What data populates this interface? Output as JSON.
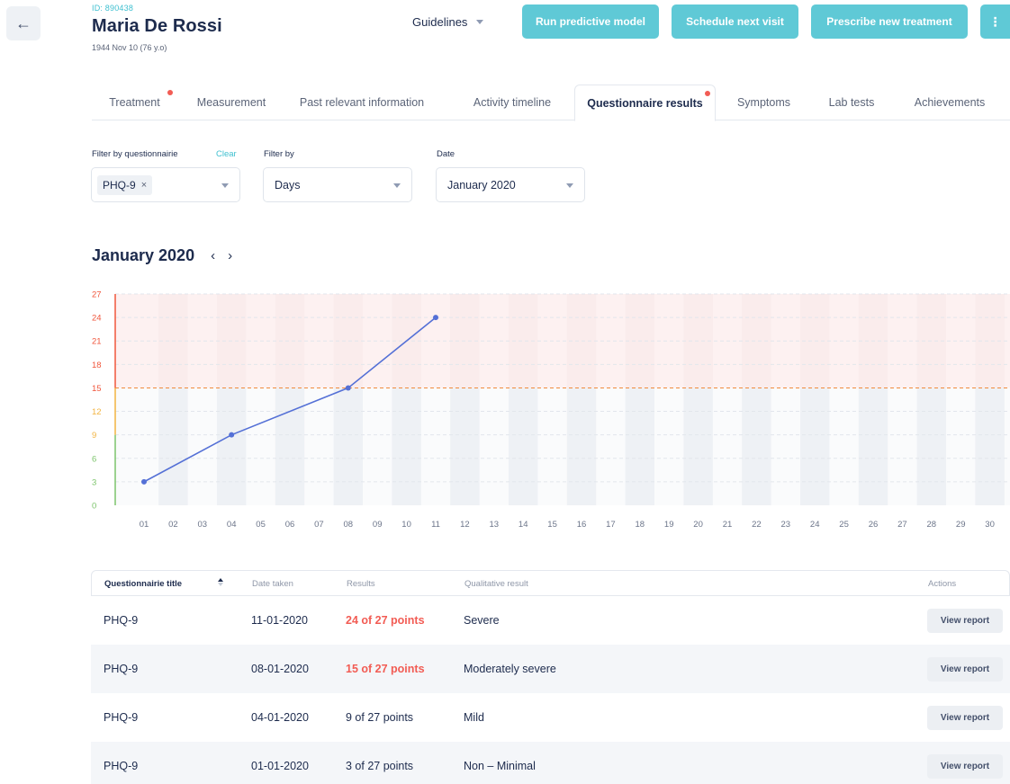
{
  "header": {
    "back_icon": "arrow-left-icon",
    "patient_id": "ID: 890438",
    "patient_name": "Maria De Rossi",
    "patient_dob": "1944 Nov 10 (76 y.o)",
    "guidelines_label": "Guidelines",
    "buttons": {
      "run_model": "Run predictive model",
      "schedule": "Schedule next visit",
      "prescribe": "Prescribe new treatment",
      "more": "⋮"
    },
    "button_color": "#5fc9d6"
  },
  "tabs": [
    {
      "label": "Treatment",
      "has_dot": true
    },
    {
      "label": "Measurement",
      "has_dot": false
    },
    {
      "label": "Past relevant information",
      "has_dot": false
    },
    {
      "label": "Activity timeline",
      "has_dot": false
    },
    {
      "label": "Questionnaire results",
      "has_dot": true,
      "active": true
    },
    {
      "label": "Symptoms",
      "has_dot": false
    },
    {
      "label": "Lab tests",
      "has_dot": false
    },
    {
      "label": "Achievements",
      "has_dot": false
    }
  ],
  "filters": {
    "questionnaire_label": "Filter by questionnairie",
    "clear_label": "Clear",
    "questionnaire_chip": "PHQ-9",
    "chip_remove": "×",
    "filter_by_label": "Filter by",
    "filter_by_value": "Days",
    "date_label": "Date",
    "date_value": "January 2020"
  },
  "month_nav": {
    "title": "January 2020",
    "prev": "‹",
    "next": "›"
  },
  "chart_data": {
    "type": "line",
    "x": [
      "01",
      "02",
      "03",
      "04",
      "05",
      "06",
      "07",
      "08",
      "09",
      "10",
      "11",
      "12",
      "13",
      "14",
      "15",
      "16",
      "17",
      "18",
      "19",
      "20",
      "21",
      "22",
      "23",
      "24",
      "25",
      "26",
      "27",
      "28",
      "29",
      "30"
    ],
    "series": [
      {
        "points": [
          {
            "x": "01",
            "y": 3
          },
          {
            "x": "04",
            "y": 9
          },
          {
            "x": "08",
            "y": 15
          },
          {
            "x": "11",
            "y": 24
          }
        ]
      }
    ],
    "yticks": [
      0,
      3,
      6,
      9,
      12,
      15,
      18,
      21,
      24,
      27
    ],
    "ylim": [
      0,
      27
    ],
    "threshold": 15,
    "grid": true,
    "colors": {
      "line": "#5470d6",
      "threshold": "#f08a3c",
      "high_zone": "#fdf1f1",
      "low_tick": "#7cc46b",
      "mid_tick": "#f2b441",
      "high_tick": "#f0563c"
    }
  },
  "table": {
    "headers": {
      "title": "Questionnairie title",
      "date": "Date taken",
      "results": "Results",
      "qualitative": "Qualitative result",
      "actions": "Actions"
    },
    "rows": [
      {
        "title": "PHQ-9",
        "date": "11-01-2020",
        "result": "24 of 27 points",
        "qualitative": "Severe",
        "highlight": true,
        "action": "View report"
      },
      {
        "title": "PHQ-9",
        "date": "08-01-2020",
        "result": "15 of 27 points",
        "qualitative": "Moderately severe",
        "highlight": true,
        "action": "View report"
      },
      {
        "title": "PHQ-9",
        "date": "04-01-2020",
        "result": "9 of 27 points",
        "qualitative": "Mild",
        "highlight": false,
        "action": "View report"
      },
      {
        "title": "PHQ-9",
        "date": "01-01-2020",
        "result": "3 of 27 points",
        "qualitative": "Non – Minimal",
        "highlight": false,
        "action": "View report"
      }
    ]
  }
}
